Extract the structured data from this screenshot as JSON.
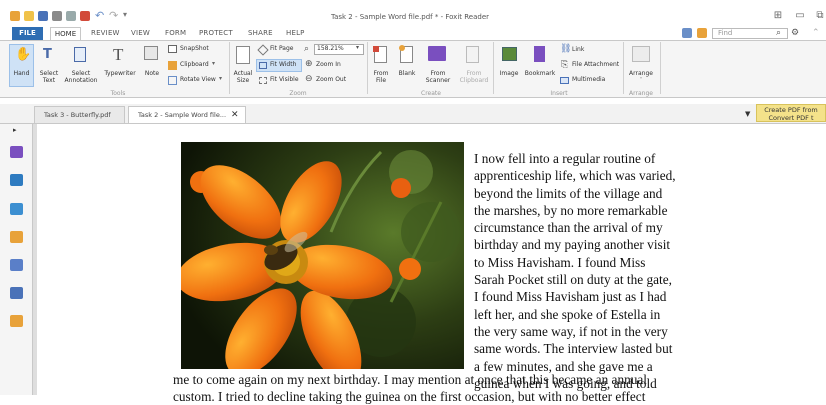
{
  "window": {
    "title": "Task 2 - Sample Word file.pdf * - Foxit Reader"
  },
  "ribbon_tabs": [
    {
      "label": "FILE"
    },
    {
      "label": "HOME"
    },
    {
      "label": "REVIEW"
    },
    {
      "label": "VIEW"
    },
    {
      "label": "FORM"
    },
    {
      "label": "PROTECT"
    },
    {
      "label": "SHARE"
    },
    {
      "label": "HELP"
    }
  ],
  "search": {
    "placeholder": "Find"
  },
  "ribbon": {
    "tools": {
      "label": "Tools",
      "hand": "Hand",
      "select_text_1": "Select",
      "select_text_2": "Text",
      "select_ann_1": "Select",
      "select_ann_2": "Annotation",
      "typewriter": "Typewriter",
      "note": "Note",
      "snapshot": "SnapShot",
      "clipboard": "Clipboard",
      "rotate_view": "Rotate View"
    },
    "zoom": {
      "label": "Zoom",
      "actual_size_1": "Actual",
      "actual_size_2": "Size",
      "fit_page": "Fit Page",
      "fit_width": "Fit Width",
      "fit_visible": "Fit Visible",
      "zoom_value": "158.21%",
      "zoom_in": "Zoom In",
      "zoom_out": "Zoom Out"
    },
    "create": {
      "label": "Create",
      "from_file_1": "From",
      "from_file_2": "File",
      "blank": "Blank",
      "from_scanner_1": "From",
      "from_scanner_2": "Scanner",
      "from_clipboard_1": "From",
      "from_clipboard_2": "Clipboard"
    },
    "insert": {
      "label": "Insert",
      "image": "Image",
      "bookmark": "Bookmark",
      "link": "Link",
      "file_attachment": "File Attachment",
      "multimedia": "Multimedia"
    },
    "arrange": {
      "label": "Arrange",
      "arrange": "Arrange"
    }
  },
  "doc_tabs": [
    {
      "label": "Task 3 - Butterfly.pdf"
    },
    {
      "label": "Task 2 - Sample Word file..."
    }
  ],
  "banner": {
    "line1": "Create PDF from",
    "line2": "Convert PDF t"
  },
  "document": {
    "right_lines": [
      "I now fell into a regular routine of",
      "apprenticeship life, which was varied,",
      "beyond the limits of the village and",
      "the marshes, by no more remarkable",
      "circumstance than the arrival of my",
      "birthday and my paying another visit",
      "to Miss Havisham. I found Miss",
      "Sarah Pocket still on duty at the gate,",
      "I found Miss Havisham just as I had",
      "left her, and she spoke of Estella in",
      "the very same way, if not in the very",
      "same words. The interview lasted but",
      "a few minutes, and she gave me a",
      "guinea when I was going, and told"
    ],
    "full_line": "me to come again on my next birthday. I may mention at once that this became an annual",
    "cut_line": "custom. I tried to decline taking the guinea on the first occasion, but with no better effect"
  },
  "colors": {
    "file_tab": "#2e6db3",
    "banner": "#f4e28a",
    "accent_purple": "#7a4fbf"
  }
}
